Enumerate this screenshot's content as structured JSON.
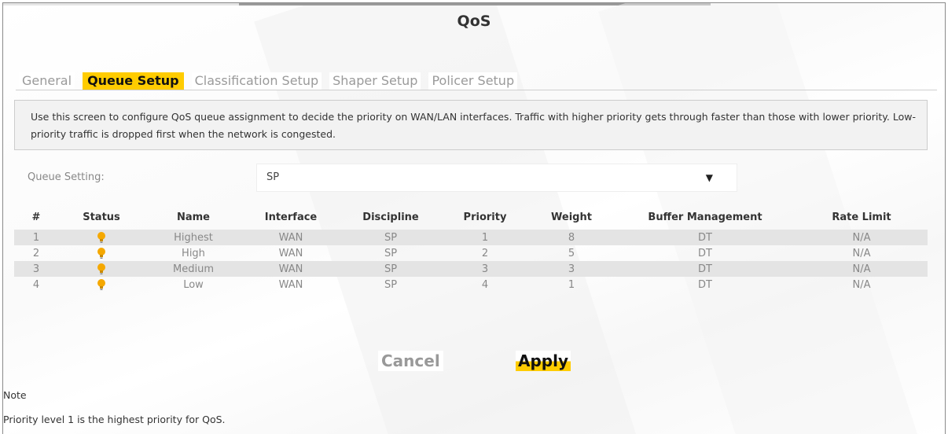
{
  "page_title": "QoS",
  "tabs": [
    {
      "label": "General",
      "active": false
    },
    {
      "label": "Queue Setup",
      "active": true
    },
    {
      "label": "Classification Setup",
      "active": false
    },
    {
      "label": "Shaper Setup",
      "active": false
    },
    {
      "label": "Policer Setup",
      "active": false
    }
  ],
  "description": "Use this screen to configure QoS queue assignment to decide the priority on WAN/LAN interfaces. Traffic with higher priority gets through faster than those with lower priority. Low-priority traffic is dropped first when the network is congested.",
  "queue_setting": {
    "label": "Queue Setting:",
    "value": "SP",
    "arrow": "▼"
  },
  "table": {
    "headers": [
      "#",
      "Status",
      "Name",
      "Interface",
      "Discipline",
      "Priority",
      "Weight",
      "Buffer Management",
      "Rate Limit"
    ],
    "rows": [
      {
        "index": "1",
        "status": "lightbulb-icon",
        "name": "Highest",
        "interface": "WAN",
        "discipline": "SP",
        "priority": "1",
        "weight": "8",
        "buffer": "DT",
        "rate": "N/A"
      },
      {
        "index": "2",
        "status": "lightbulb-icon",
        "name": "High",
        "interface": "WAN",
        "discipline": "SP",
        "priority": "2",
        "weight": "5",
        "buffer": "DT",
        "rate": "N/A"
      },
      {
        "index": "3",
        "status": "lightbulb-icon",
        "name": "Medium",
        "interface": "WAN",
        "discipline": "SP",
        "priority": "3",
        "weight": "3",
        "buffer": "DT",
        "rate": "N/A"
      },
      {
        "index": "4",
        "status": "lightbulb-icon",
        "name": "Low",
        "interface": "WAN",
        "discipline": "SP",
        "priority": "4",
        "weight": "1",
        "buffer": "DT",
        "rate": "N/A"
      }
    ]
  },
  "buttons": {
    "cancel": "Cancel",
    "apply": "Apply"
  },
  "note": {
    "title": "Note",
    "text": "Priority level 1 is the highest priority for QoS."
  },
  "colors": {
    "accent": "#ffcc00",
    "bulb": "#f5a800",
    "row_shade": "#e4e4e4"
  }
}
